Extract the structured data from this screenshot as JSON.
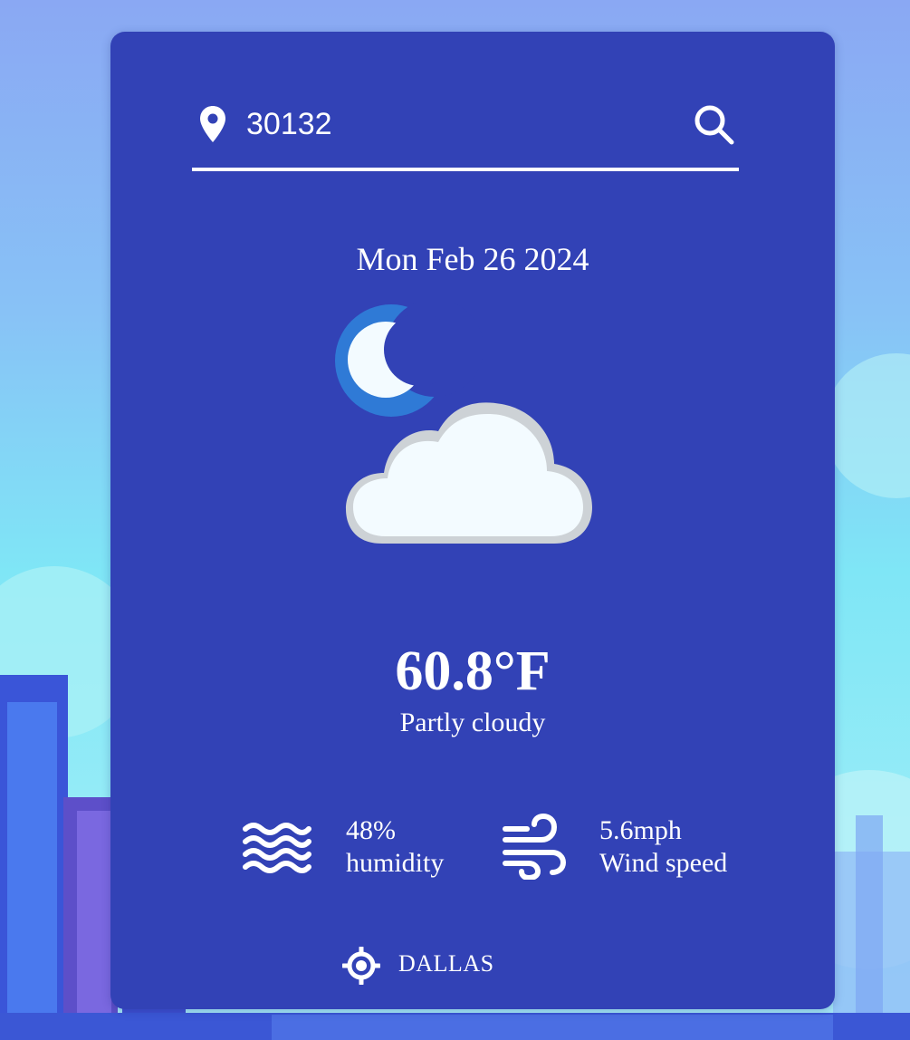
{
  "search": {
    "value": "30132",
    "icon": "search-icon",
    "pin_icon": "map-pin-icon"
  },
  "weather": {
    "date": "Mon Feb 26 2024",
    "icon": "partly-cloudy-night-icon",
    "temperature": "60.8°F",
    "condition": "Partly cloudy",
    "humidity_value": "48%",
    "humidity_label": "humidity",
    "humidity_icon": "waves-icon",
    "wind_value": "5.6mph",
    "wind_label": "Wind speed",
    "wind_icon": "wind-icon",
    "city": "DALLAS",
    "city_icon": "location-crosshair-icon"
  },
  "colors": {
    "card": "#3242b6",
    "text": "#ffffff",
    "moon_outer": "#2f7ad6",
    "cloud": "#ffffff"
  }
}
